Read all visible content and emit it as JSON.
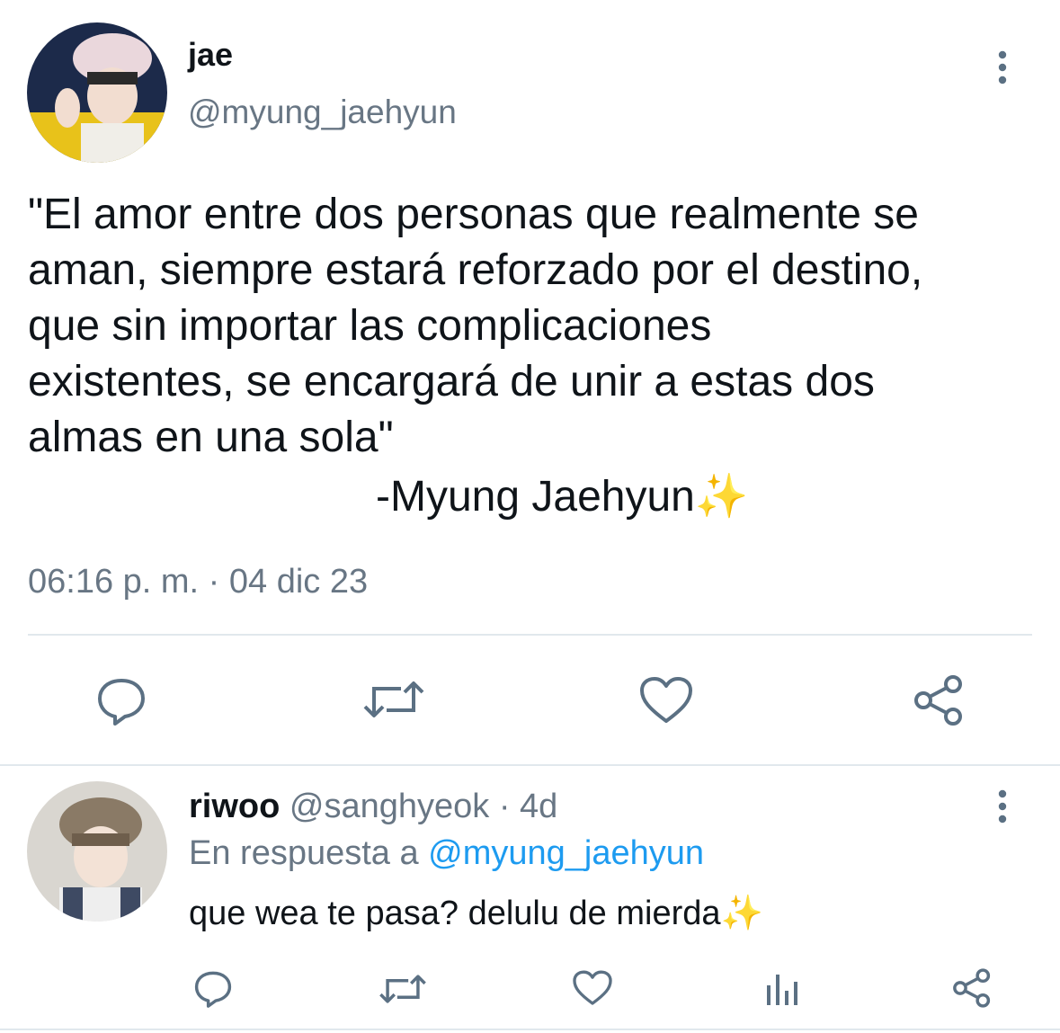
{
  "main_tweet": {
    "display_name": "jae",
    "handle": "@myung_jaehyun",
    "text_lines": [
      "\"El amor entre dos personas que realmente se",
      "aman, siempre estará reforzado por el destino,",
      "que sin importar las complicaciones",
      "existentes, se encargará de unir a estas dos",
      "almas en una sola\""
    ],
    "signature": "-Myung Jaehyun✨",
    "timestamp": "06:16 p. m. · 04 dic 23",
    "actions": [
      "reply-icon",
      "retweet-icon",
      "like-icon",
      "share-icon"
    ]
  },
  "reply_tweet": {
    "display_name": "riwoo",
    "handle_time": "@sanghyeok · 4d",
    "reply_to_prefix": "En respuesta a",
    "reply_to_handle": "@myung_jaehyun",
    "text": "que wea te pasa? delulu de mierda✨",
    "actions": [
      "reply-icon",
      "retweet-icon",
      "like-icon",
      "analytics-icon",
      "share-icon"
    ]
  },
  "colors": {
    "text": "#0f1419",
    "muted": "#687684",
    "link": "#1d9bf0",
    "divider": "#e1e8ed",
    "icon": "#5b7083"
  }
}
